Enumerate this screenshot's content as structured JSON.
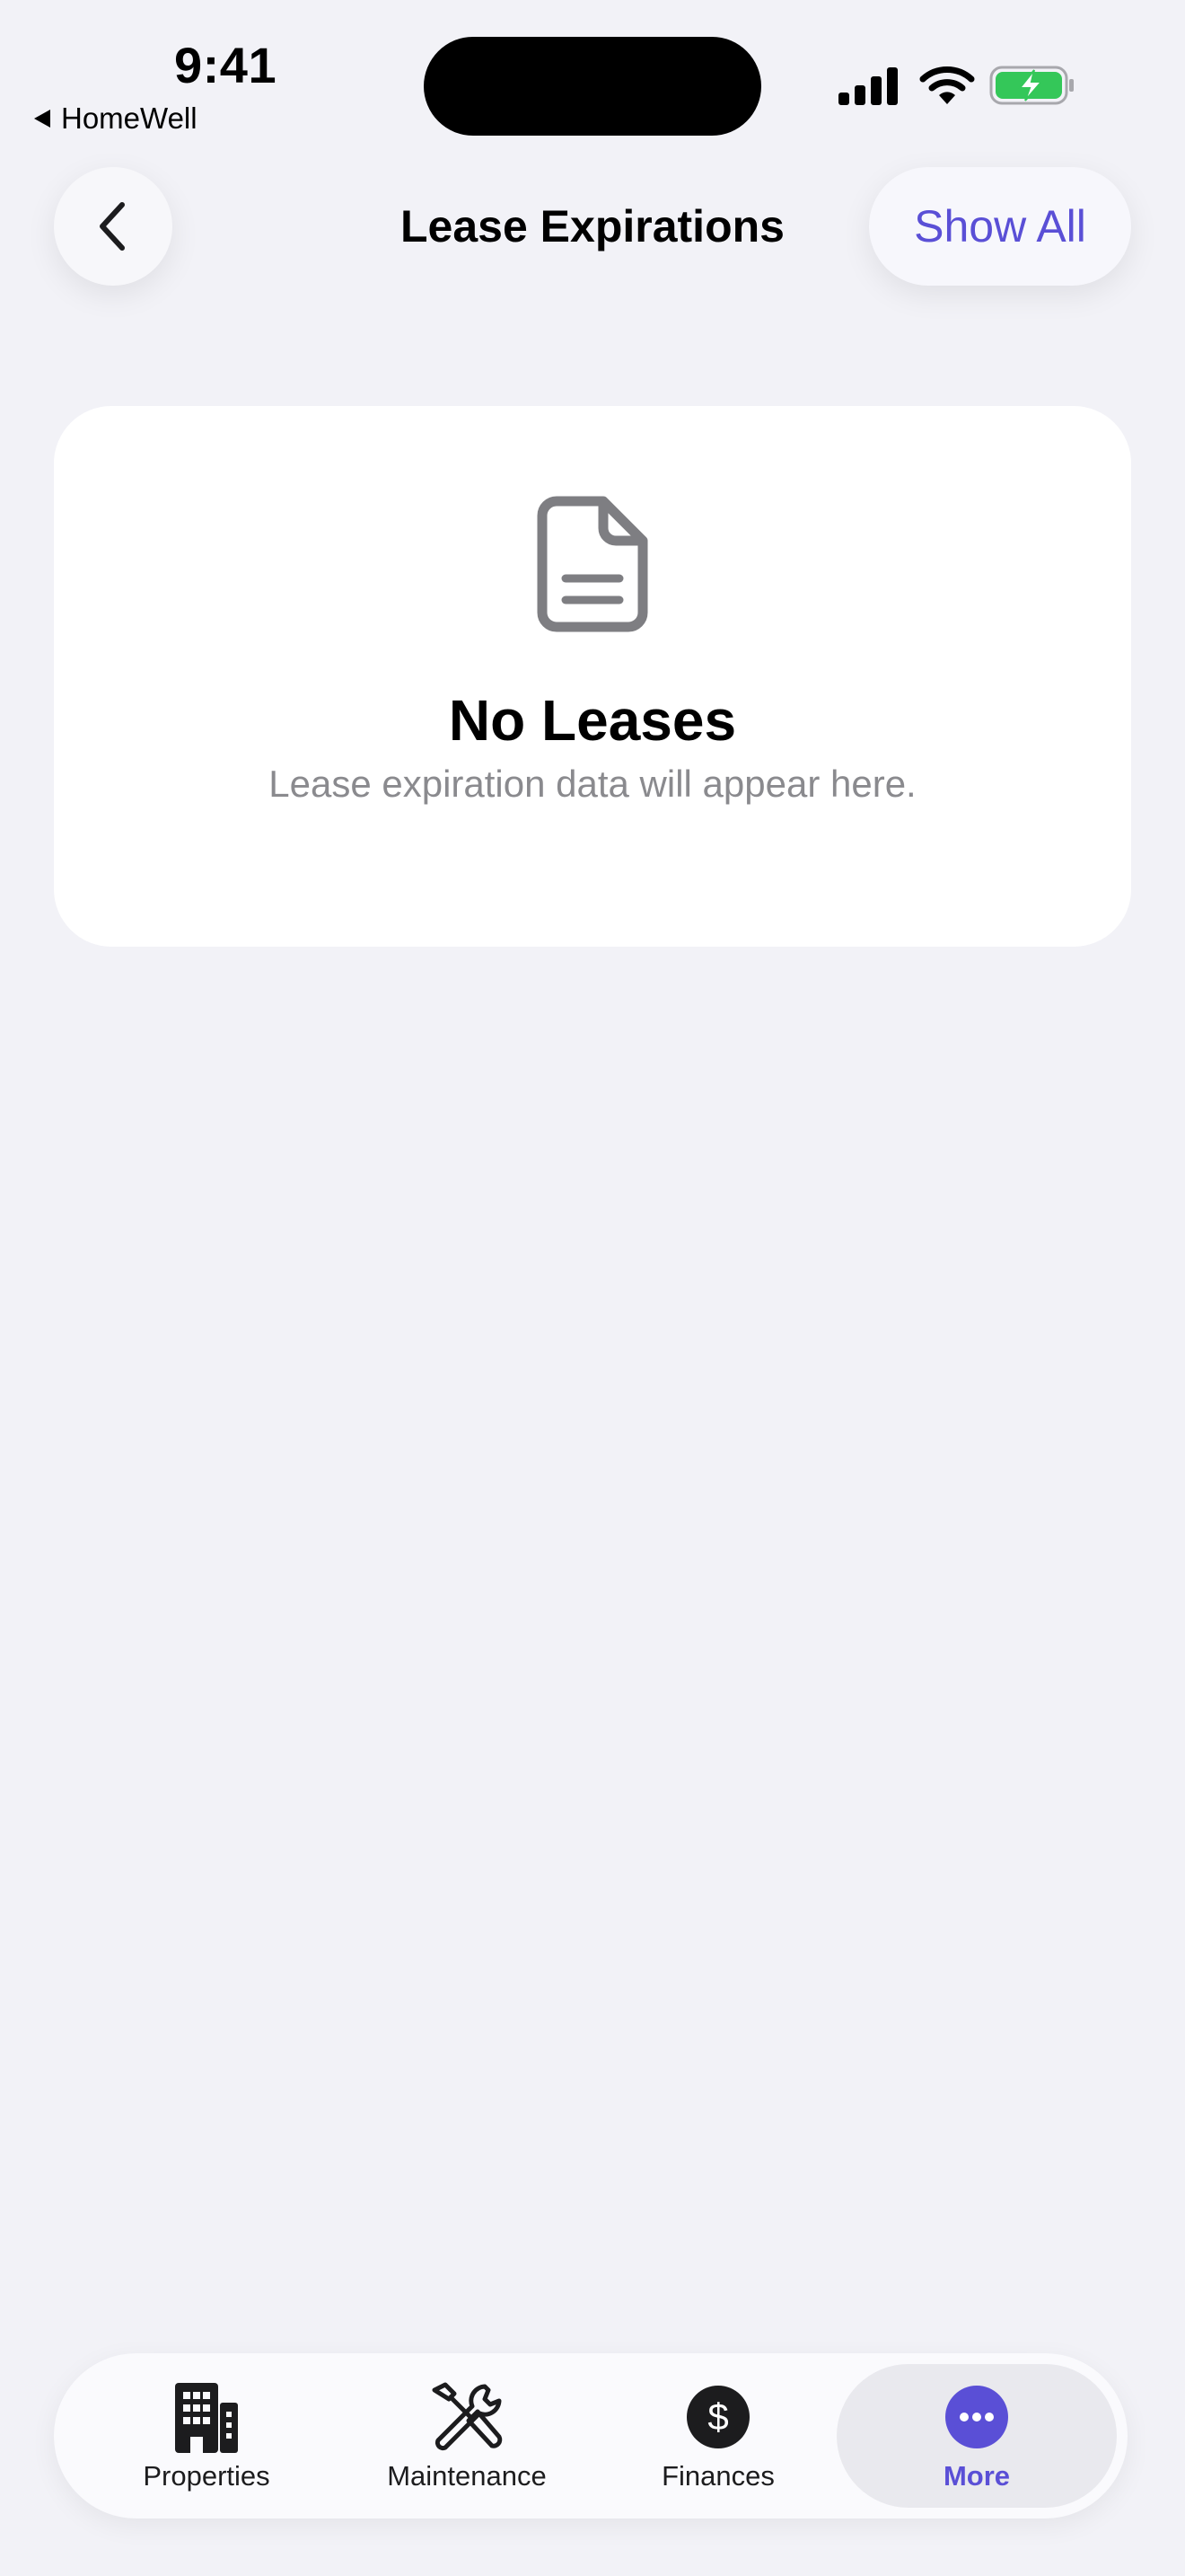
{
  "status_bar": {
    "time": "9:41",
    "back_app": "HomeWell"
  },
  "nav": {
    "title": "Lease Expirations",
    "action_label": "Show All",
    "back_icon": "chevron-left-icon"
  },
  "empty_state": {
    "icon": "document-icon",
    "title": "No Leases",
    "subtitle": "Lease expiration data will appear here."
  },
  "tab_bar": {
    "tabs": [
      {
        "label": "Properties",
        "icon": "building-icon",
        "selected": false
      },
      {
        "label": "Maintenance",
        "icon": "wrench-screwdriver-icon",
        "selected": false
      },
      {
        "label": "Finances",
        "icon": "dollar-circle-icon",
        "selected": false
      },
      {
        "label": "More",
        "icon": "ellipsis-circle-icon",
        "selected": true
      }
    ]
  },
  "colors": {
    "accent": "#5A4FD6",
    "background": "#F2F2F7",
    "card": "#FFFFFF",
    "secondary_text": "#8A8A8E",
    "battery": "#34C759"
  }
}
